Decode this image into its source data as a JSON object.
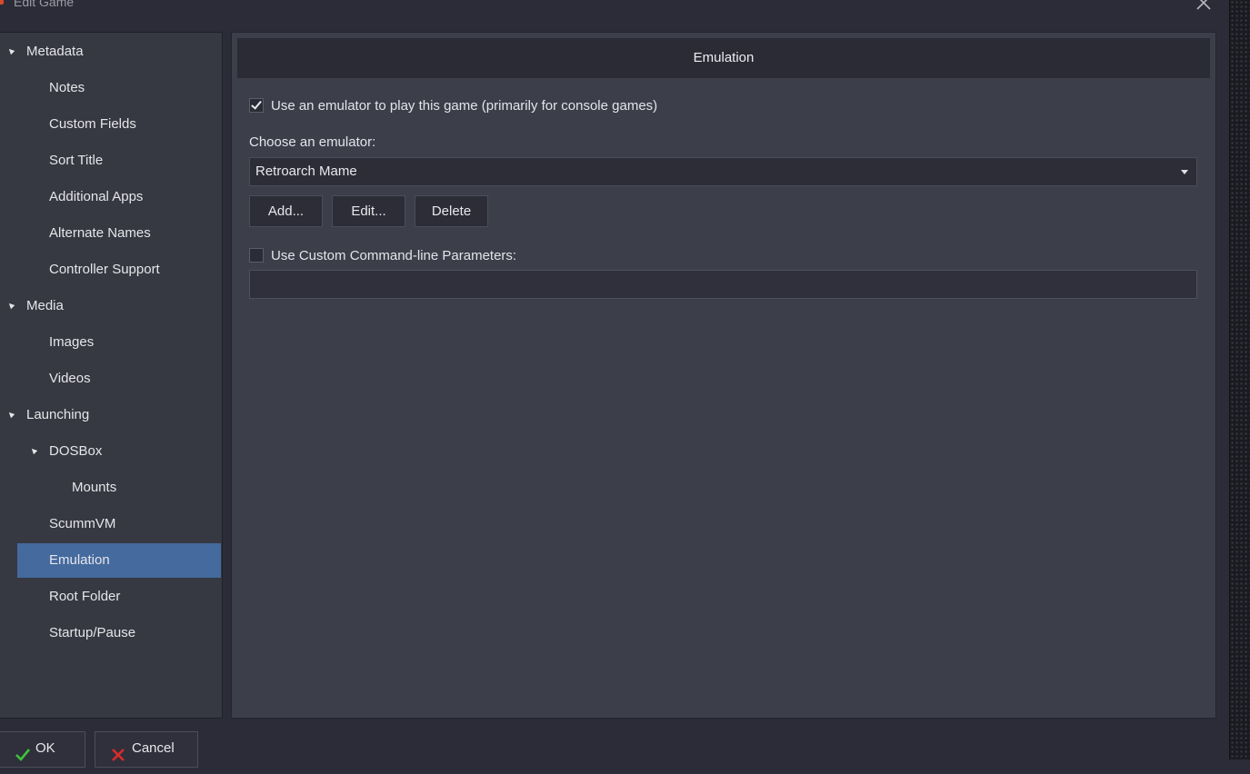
{
  "window": {
    "title": "Edit Game",
    "close_icon": "close-icon"
  },
  "sidebar": {
    "items": [
      {
        "label": "Metadata",
        "level": 0,
        "expanded": true
      },
      {
        "label": "Notes",
        "level": 1
      },
      {
        "label": "Custom Fields",
        "level": 1
      },
      {
        "label": "Sort Title",
        "level": 1
      },
      {
        "label": "Additional Apps",
        "level": 1
      },
      {
        "label": "Alternate Names",
        "level": 1
      },
      {
        "label": "Controller Support",
        "level": 1
      },
      {
        "label": "Media",
        "level": 0,
        "expanded": true
      },
      {
        "label": "Images",
        "level": 1
      },
      {
        "label": "Videos",
        "level": 1
      },
      {
        "label": "Launching",
        "level": 0,
        "expanded": true
      },
      {
        "label": "DOSBox",
        "level": 1,
        "expanded": true
      },
      {
        "label": "Mounts",
        "level": 2
      },
      {
        "label": "ScummVM",
        "level": 1
      },
      {
        "label": "Emulation",
        "level": 1,
        "selected": true
      },
      {
        "label": "Root Folder",
        "level": 1
      },
      {
        "label": "Startup/Pause",
        "level": 1
      }
    ]
  },
  "panel": {
    "header": "Emulation",
    "use_emulator": {
      "label": "Use an emulator to play this game (primarily for console games)",
      "checked": true
    },
    "choose_label": "Choose an emulator:",
    "emulator_select": {
      "value": "Retroarch Mame"
    },
    "buttons": {
      "add": "Add...",
      "edit": "Edit...",
      "delete": "Delete"
    },
    "custom_params": {
      "label": "Use Custom Command-line Parameters:",
      "checked": false,
      "value": ""
    }
  },
  "footer": {
    "ok": "OK",
    "cancel": "Cancel"
  },
  "colors": {
    "selected": "#446a9e",
    "ok_icon": "#3cc43c",
    "cancel_icon": "#d82b2b"
  }
}
